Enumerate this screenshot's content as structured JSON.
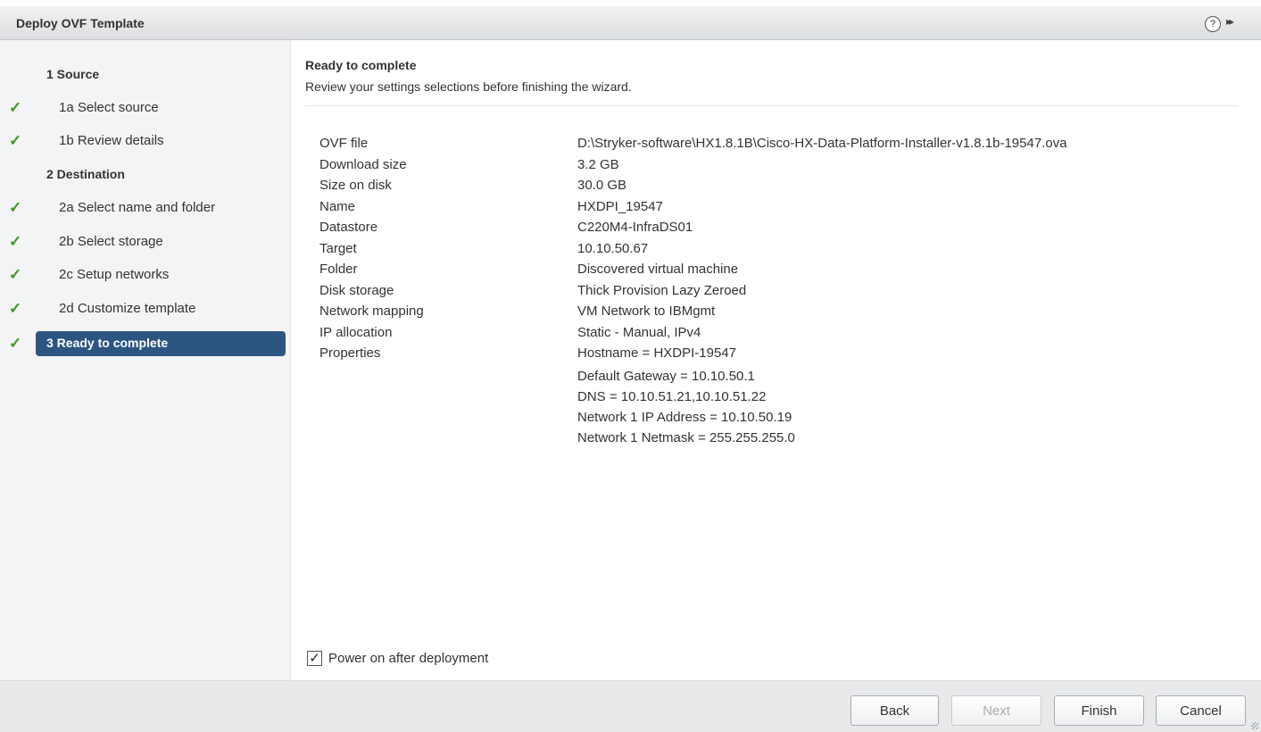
{
  "window": {
    "title": "Deploy OVF Template",
    "help_icon": "?",
    "expand_icon": "▸▸"
  },
  "steps": [
    {
      "label": "1  Source",
      "type": "header",
      "checked": false
    },
    {
      "label": "1a  Select source",
      "type": "sub",
      "checked": true
    },
    {
      "label": "1b  Review details",
      "type": "sub",
      "checked": true
    },
    {
      "label": "2  Destination",
      "type": "header",
      "checked": false
    },
    {
      "label": "2a  Select name and folder",
      "type": "sub",
      "checked": true
    },
    {
      "label": "2b  Select storage",
      "type": "sub",
      "checked": true
    },
    {
      "label": "2c  Setup networks",
      "type": "sub",
      "checked": true
    },
    {
      "label": "2d  Customize template",
      "type": "sub",
      "checked": true
    },
    {
      "label": "3  Ready to complete",
      "type": "active",
      "checked": true
    }
  ],
  "main": {
    "heading": "Ready to complete",
    "subheading": "Review your settings selections before finishing the wizard.",
    "rows": [
      {
        "key": "OVF file",
        "value": "D:\\Stryker-software\\HX1.8.1B\\Cisco-HX-Data-Platform-Installer-v1.8.1b-19547.ova"
      },
      {
        "key": "Download size",
        "value": "3.2 GB"
      },
      {
        "key": "Size on disk",
        "value": "30.0 GB"
      },
      {
        "key": "Name",
        "value": "HXDPI_19547"
      },
      {
        "key": "Datastore",
        "value": "C220M4-InfraDS01"
      },
      {
        "key": "Target",
        "value": "10.10.50.67"
      },
      {
        "key": "Folder",
        "value": "Discovered virtual machine"
      },
      {
        "key": "Disk storage",
        "value": "Thick Provision Lazy Zeroed"
      },
      {
        "key": "Network mapping",
        "value": "VM Network to IBMgmt"
      },
      {
        "key": "IP allocation",
        "value": "Static - Manual, IPv4"
      },
      {
        "key": "Properties",
        "value": "Hostname = HXDPI-19547"
      }
    ],
    "properties_extra": [
      "Default Gateway = 10.10.50.1",
      "DNS = 10.10.51.21,10.10.51.22",
      "Network 1 IP Address = 10.10.50.19",
      "Network 1 Netmask = 255.255.255.0"
    ],
    "power_on_label": "Power on after deployment",
    "power_on_checked": true
  },
  "footer": {
    "back": "Back",
    "next": "Next",
    "finish": "Finish",
    "cancel": "Cancel"
  },
  "colors": {
    "accent": "#2c5581",
    "check": "#3c9a22"
  }
}
